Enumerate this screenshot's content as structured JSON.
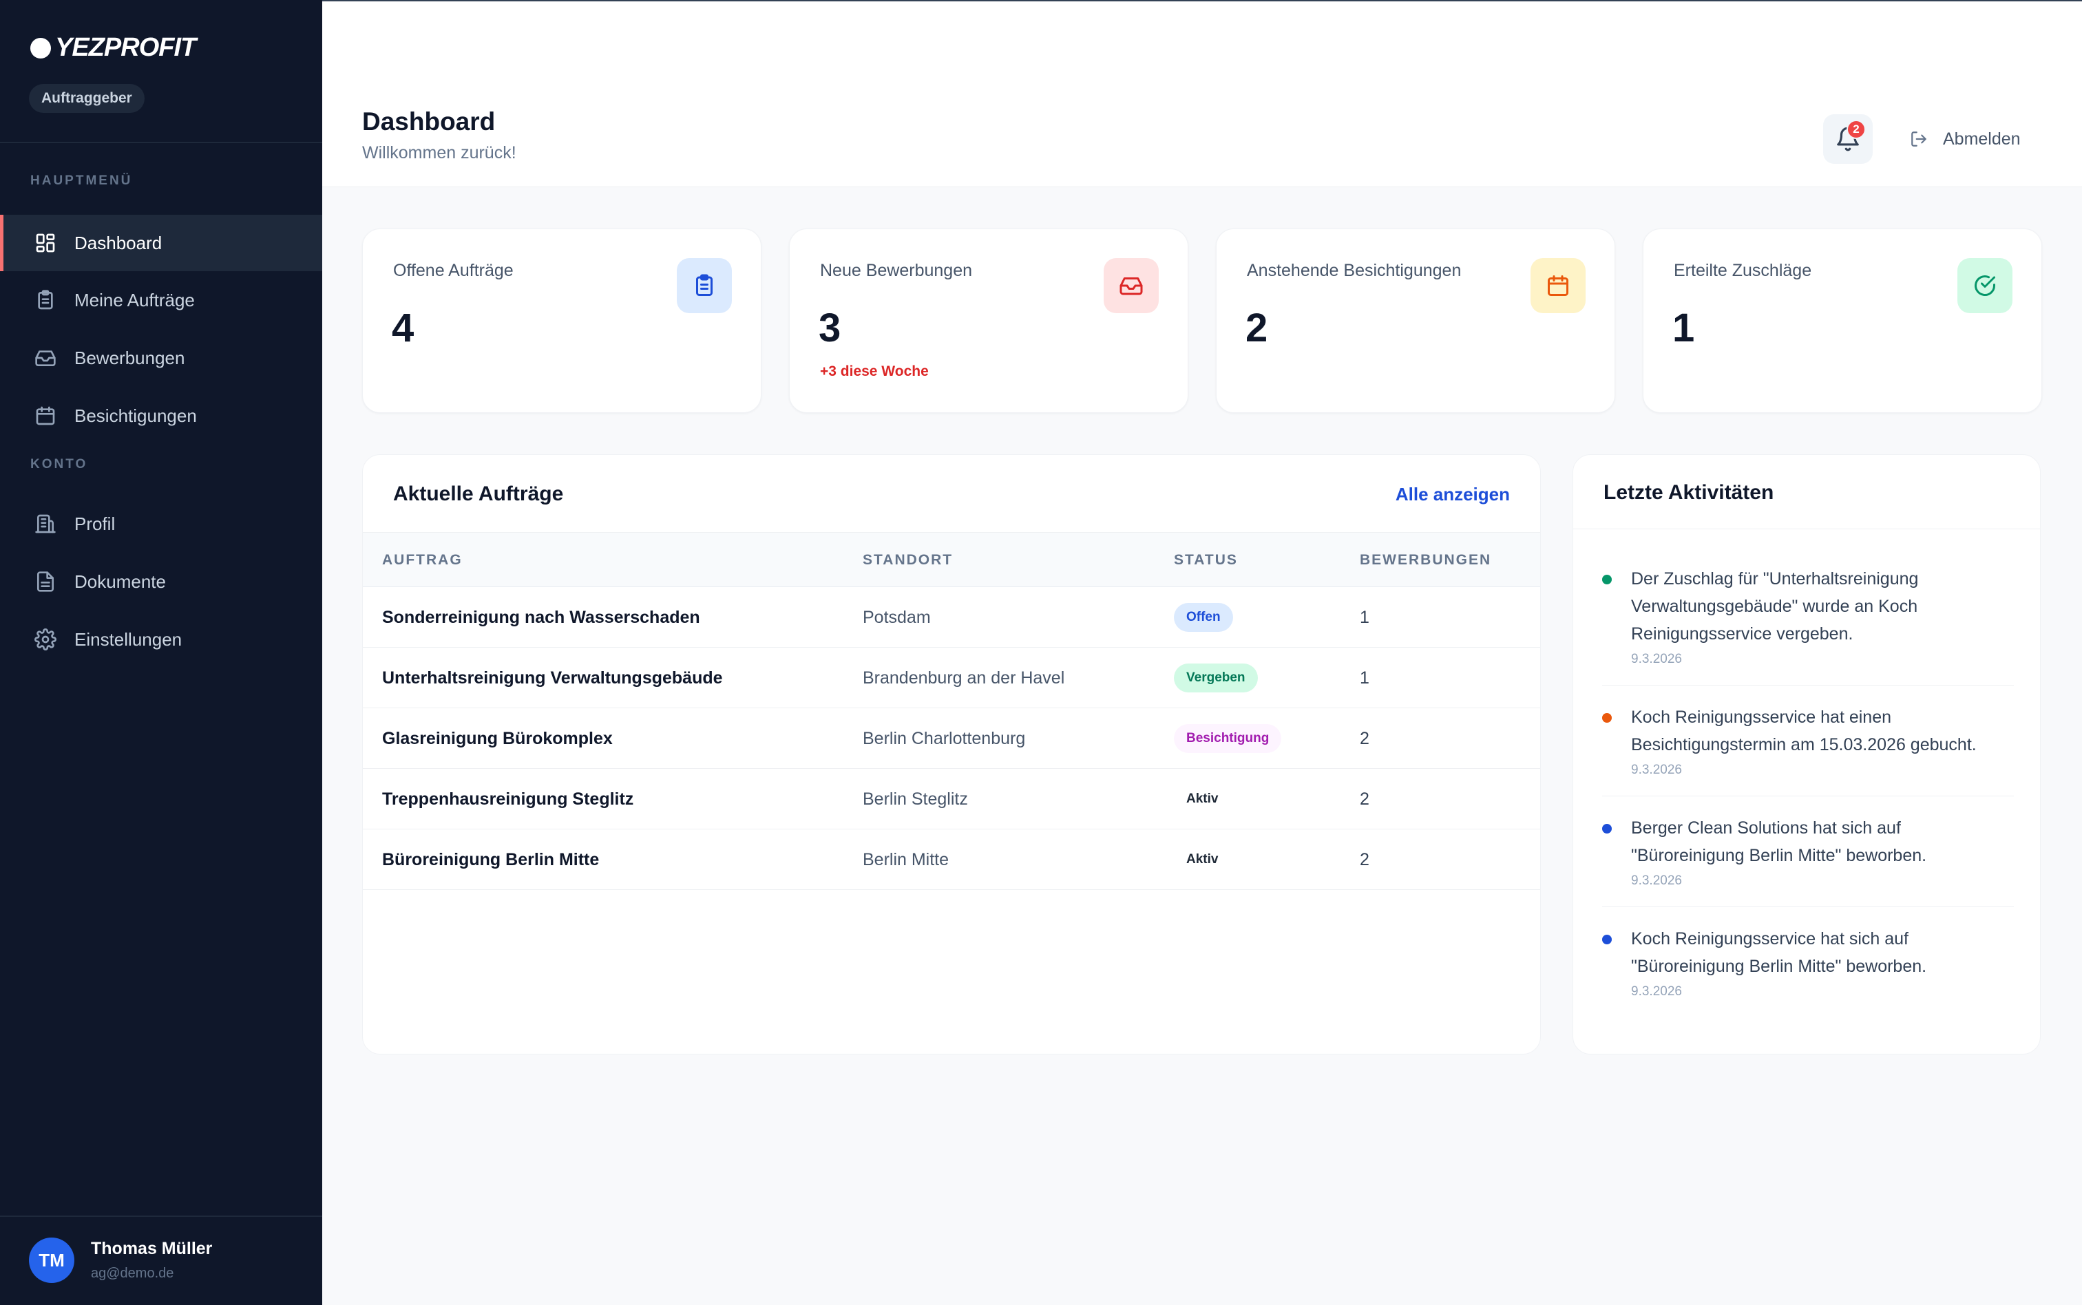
{
  "brand": {
    "name": "YEZPROFIT",
    "role": "Auftraggeber"
  },
  "sidebar": {
    "main_section": "HAUPTMENÜ",
    "account_section": "KONTO",
    "items": [
      {
        "label": "Dashboard",
        "icon": "dashboard-icon",
        "active": true
      },
      {
        "label": "Meine Aufträge",
        "icon": "clipboard-icon"
      },
      {
        "label": "Bewerbungen",
        "icon": "inbox-icon"
      },
      {
        "label": "Besichtigungen",
        "icon": "calendar-icon"
      },
      {
        "label": "Profil",
        "icon": "building-icon"
      },
      {
        "label": "Dokumente",
        "icon": "document-icon"
      },
      {
        "label": "Einstellungen",
        "icon": "gear-icon"
      }
    ],
    "user": {
      "initials": "TM",
      "name": "Thomas Müller",
      "email": "ag@demo.de"
    }
  },
  "header": {
    "title": "Dashboard",
    "subtitle": "Willkommen zurück!",
    "notification_count": "2",
    "logout_label": "Abmelden"
  },
  "stats": [
    {
      "label": "Offene Aufträge",
      "value": "4",
      "note": "",
      "icon": "clipboard-icon",
      "color": "#1d4ed8",
      "bg": "#dbeafe"
    },
    {
      "label": "Neue Bewerbungen",
      "value": "3",
      "note": "+3 diese Woche",
      "icon": "inbox-icon",
      "color": "#dc2626",
      "bg": "#fee2e2"
    },
    {
      "label": "Anstehende Besichtigungen",
      "value": "2",
      "note": "",
      "icon": "calendar-icon",
      "color": "#ea580c",
      "bg": "#fef3c7"
    },
    {
      "label": "Erteilte Zuschläge",
      "value": "1",
      "note": "",
      "icon": "check-circle-icon",
      "color": "#059669",
      "bg": "#d1fae5"
    }
  ],
  "orders": {
    "title": "Aktuelle Aufträge",
    "view_all": "Alle anzeigen",
    "columns": [
      "AUFTRAG",
      "STANDORT",
      "STATUS",
      "BEWERBUNGEN"
    ],
    "rows": [
      {
        "title": "Sonderreinigung nach Wasserschaden",
        "location": "Potsdam",
        "status": "Offen",
        "status_key": "offen",
        "applications": "1"
      },
      {
        "title": "Unterhaltsreinigung Verwaltungsgebäude",
        "location": "Brandenburg an der Havel",
        "status": "Vergeben",
        "status_key": "vergeben",
        "applications": "1"
      },
      {
        "title": "Glasreinigung Bürokomplex",
        "location": "Berlin Charlottenburg",
        "status": "Besichtigung",
        "status_key": "besichtigung",
        "applications": "2"
      },
      {
        "title": "Treppenhausreinigung Steglitz",
        "location": "Berlin Steglitz",
        "status": "Aktiv",
        "status_key": "aktiv",
        "applications": "2"
      },
      {
        "title": "Büroreinigung Berlin Mitte",
        "location": "Berlin Mitte",
        "status": "Aktiv",
        "status_key": "aktiv",
        "applications": "2"
      }
    ]
  },
  "activities": {
    "title": "Letzte Aktivitäten",
    "items": [
      {
        "text": "Der Zuschlag für \"Unterhaltsreinigung Verwaltungsgebäude\" wurde an Koch Reinigungsservice vergeben.",
        "date": "9.3.2026",
        "color": "#059669"
      },
      {
        "text": "Koch Reinigungsservice hat einen Besichtigungstermin am 15.03.2026 gebucht.",
        "date": "9.3.2026",
        "color": "#ea580c"
      },
      {
        "text": "Berger Clean Solutions hat sich auf \"Büroreinigung Berlin Mitte\" beworben.",
        "date": "9.3.2026",
        "color": "#1d4ed8"
      },
      {
        "text": "Koch Reinigungsservice hat sich auf \"Büroreinigung Berlin Mitte\" beworben.",
        "date": "9.3.2026",
        "color": "#1d4ed8"
      }
    ]
  }
}
